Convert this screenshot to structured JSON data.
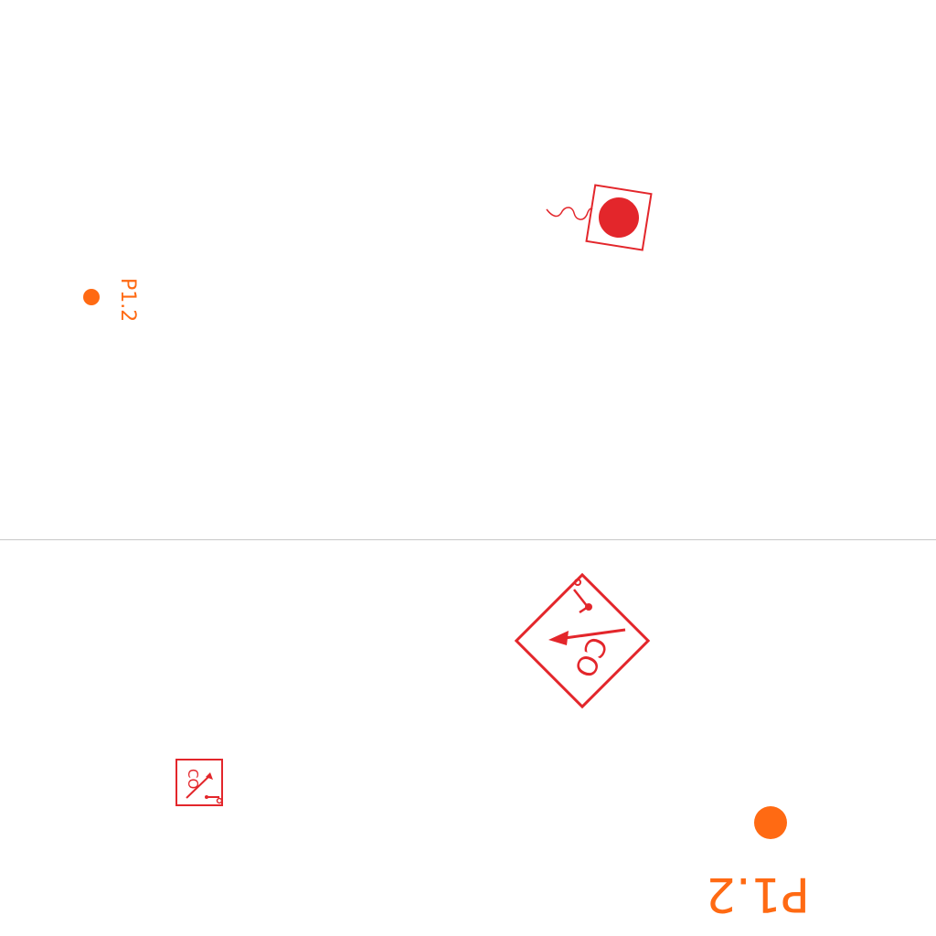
{
  "colors": {
    "symbol_red": "#e3262b",
    "point_orange": "#ff6a13",
    "divider": "#c8c8c8",
    "background": "#ffffff"
  },
  "top_panel": {
    "point": {
      "label": "P1.2",
      "icon": "point-dot-icon"
    },
    "device": {
      "icon": "signal-lamp-icon"
    }
  },
  "bottom_panel": {
    "small_device": {
      "label": "CO",
      "icon": "co-detector-icon"
    },
    "large_device": {
      "label": "CO",
      "icon": "co-detector-icon"
    },
    "point": {
      "label": "P1.2",
      "icon": "point-dot-icon"
    }
  }
}
